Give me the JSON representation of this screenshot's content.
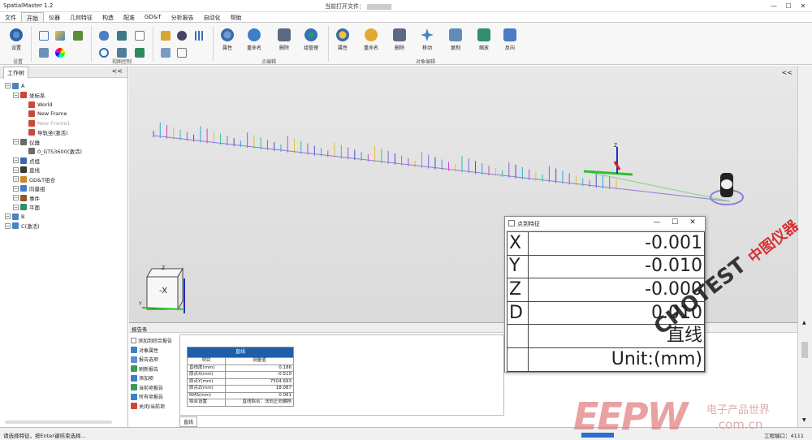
{
  "app": {
    "title": "SpatialMaster 1.2",
    "doc_prefix": "当前打开文件："
  },
  "menubar": [
    "文件",
    "开始",
    "仪器",
    "几何特征",
    "构造",
    "配准",
    "GD&T",
    "分析报告",
    "自动化",
    "帮助"
  ],
  "ribbon": {
    "settings_label": "设置",
    "group_settings": "设置",
    "group_view": "视图控制",
    "group_point_edit": "点编辑",
    "group_object_edit": "对象编辑",
    "buttons": {
      "attr1": "属性",
      "rename1": "重命名",
      "delete1": "删除",
      "groupmgr": "组管理",
      "attr2": "属性",
      "rename2": "重命名",
      "delete2": "删除",
      "move": "移动",
      "copy": "复制",
      "scale": "缩放",
      "reverse": "反向"
    }
  },
  "left_panel": {
    "tab": "工作树",
    "collapse": "<<",
    "tree": [
      {
        "label": "A",
        "indent": 0
      },
      {
        "label": "坐标系",
        "indent": 1
      },
      {
        "label": "World",
        "indent": 2
      },
      {
        "label": "New Frame",
        "indent": 2
      },
      {
        "label": "New Frame1",
        "indent": 2
      },
      {
        "label": "导轨坐(激活)",
        "indent": 2
      },
      {
        "label": "仪器",
        "indent": 1
      },
      {
        "label": "0_GTS3600(激活)",
        "indent": 2
      },
      {
        "label": "点组",
        "indent": 1
      },
      {
        "label": "直线",
        "indent": 1
      },
      {
        "label": "GD&T组合",
        "indent": 1
      },
      {
        "label": "向量组",
        "indent": 1
      },
      {
        "label": "事件",
        "indent": 1
      },
      {
        "label": "平面",
        "indent": 1
      },
      {
        "label": "B",
        "indent": 0
      },
      {
        "label": "C(激活)",
        "indent": 0
      }
    ]
  },
  "viewport": {
    "collapse": "<<",
    "cube_face": "-X",
    "axis_z": "Z",
    "axis_y": "Y"
  },
  "report": {
    "title": "报告条",
    "options": [
      "添加到综合报告",
      "对象属性",
      "报告选项",
      "刷新报告",
      "添加项",
      "当前项报告",
      "所有项报告",
      "关闭/当前项"
    ],
    "table_title": "直线",
    "col_item": "项目",
    "col_value": "测量值",
    "rows": [
      [
        "直线度(mm)",
        "0.186"
      ],
      [
        "原点X(mm)",
        "-0.510"
      ],
      [
        "原点Y(mm)",
        "7504.693"
      ],
      [
        "原点Z(mm)",
        "18.087"
      ],
      [
        "RMS(mm)",
        "0.061"
      ],
      [
        "拟合设置",
        "直线拟合：法向正向偏移"
      ]
    ],
    "tab": "直线"
  },
  "dialog": {
    "title": "点到特征",
    "rows": [
      {
        "key": "X",
        "value": "-0.001"
      },
      {
        "key": "Y",
        "value": "-0.010"
      },
      {
        "key": "Z",
        "value": "-0.000"
      },
      {
        "key": "D",
        "value": "0.010"
      },
      {
        "key": "",
        "value": "直线"
      },
      {
        "key": "",
        "value": "Unit:(mm)"
      }
    ]
  },
  "statusbar": {
    "message": "请选择特征，按Enter键结束选择...",
    "workspace": "工程端口：4111"
  },
  "watermarks": {
    "chotest": "CHOTEST",
    "chotest_cn": "中图仪器",
    "eepw": "EEPW",
    "eepw_cn": "电子产品世界",
    "eepw_url": ".com.cn"
  },
  "colors": {
    "report_header": "#1f5fa8",
    "selection_ring": "#8b7fd6",
    "green_axis": "#2fbf2f"
  }
}
